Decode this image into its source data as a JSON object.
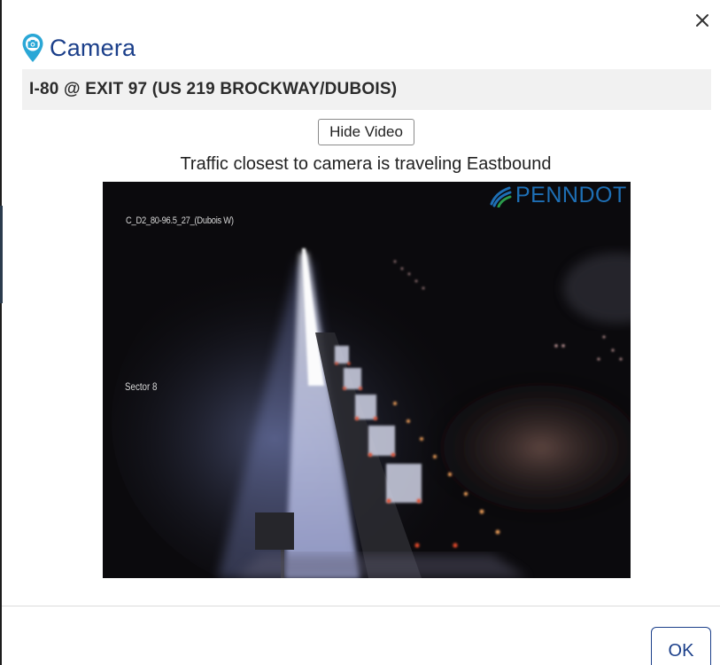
{
  "dialog": {
    "title": "Camera",
    "close_icon": "close-icon",
    "header_icon": "camera-pin-icon",
    "location": "I-80 @ EXIT 97 (US 219 BROCKWAY/DUBOIS)",
    "hide_video_label": "Hide Video",
    "direction_text": "Traffic closest to camera is traveling Eastbound",
    "ok_label": "OK",
    "accent_color": "#1b3f8a",
    "pin_color": "#2aa7d6"
  },
  "video": {
    "camera_id": "C_D2_80-96.5_27_(Dubois W)",
    "sector": "Sector 8",
    "brand": "PENNDOT",
    "brand_color": "#1e6fb5"
  }
}
